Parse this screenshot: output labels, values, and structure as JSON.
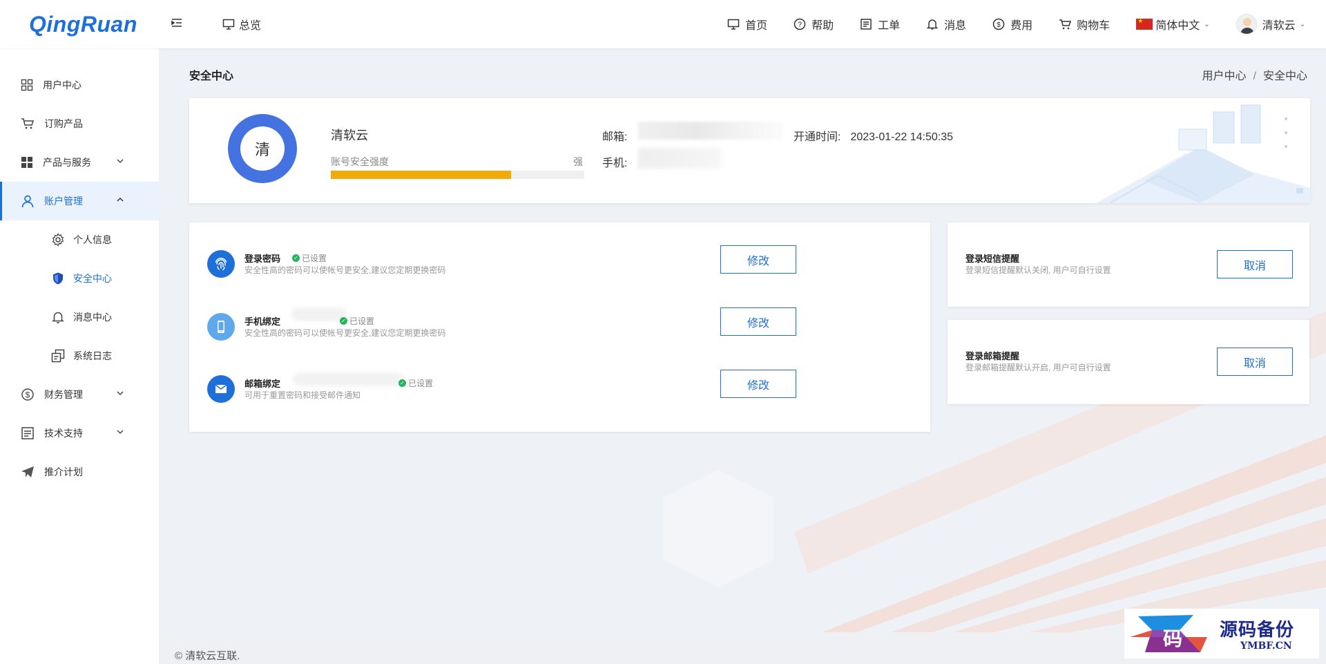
{
  "header": {
    "logo": "QingRuan",
    "overview": "总览",
    "nav": [
      {
        "label": "首页",
        "icon": "monitor-icon"
      },
      {
        "label": "帮助",
        "icon": "help-icon"
      },
      {
        "label": "工单",
        "icon": "ticket-icon"
      },
      {
        "label": "消息",
        "icon": "bell-icon"
      },
      {
        "label": "费用",
        "icon": "dollar-icon"
      },
      {
        "label": "购物车",
        "icon": "cart-icon"
      }
    ],
    "language": "简体中文",
    "username": "清软云"
  },
  "sidebar": {
    "items": [
      {
        "label": "用户中心",
        "icon": "grid-icon"
      },
      {
        "label": "订购产品",
        "icon": "cart-icon"
      },
      {
        "label": "产品与服务",
        "icon": "apps-icon"
      },
      {
        "label": "账户管理",
        "icon": "user-icon"
      }
    ],
    "sub_items": [
      {
        "label": "个人信息",
        "icon": "gear-icon"
      },
      {
        "label": "安全中心",
        "icon": "shield-icon"
      },
      {
        "label": "消息中心",
        "icon": "bell-icon"
      },
      {
        "label": "系统日志",
        "icon": "log-icon"
      }
    ],
    "items_after": [
      {
        "label": "财务管理",
        "icon": "dollar-icon"
      },
      {
        "label": "技术支持",
        "icon": "document-icon"
      },
      {
        "label": "推介计划",
        "icon": "send-icon"
      }
    ]
  },
  "page": {
    "title": "安全中心",
    "breadcrumb": [
      "用户中心",
      "安全中心"
    ]
  },
  "profile": {
    "avatar_char": "清",
    "name": "清软云",
    "strength_label": "账号安全强度",
    "strength_end": "强",
    "strength_level": 0.71,
    "email_label": "邮箱:",
    "phone_label": "手机:",
    "open_time_label": "开通时间:",
    "open_time": "2023-01-22 14:50:35"
  },
  "security": {
    "items": [
      {
        "title": "登录密码",
        "status": "已设置",
        "desc": "安全性高的密码可以使帐号更安全,建议您定期更换密码",
        "button": "修改",
        "icon": "fingerprint-icon"
      },
      {
        "title": "手机绑定",
        "status": "已设置",
        "desc": "安全性高的密码可以使帐号更安全,建议您定期更换密码",
        "button": "修改",
        "icon": "phone-icon"
      },
      {
        "title": "邮箱绑定",
        "status": "已设置",
        "desc": "可用于重置密码和接受邮件通知",
        "button": "修改",
        "icon": "mail-icon"
      }
    ]
  },
  "reminders": [
    {
      "title": "登录短信提醒",
      "desc": "登录短信提醒默认关闭, 用户可自行设置",
      "button": "取消"
    },
    {
      "title": "登录邮箱提醒",
      "desc": "登录邮箱提醒默认开启, 用户可自行设置",
      "button": "取消"
    }
  ],
  "footer": {
    "copyright": "© 清软云互联."
  },
  "watermark": {
    "text": "源码备份",
    "sub": "YMBF.CN"
  },
  "colors": {
    "primary": "#1e6fd9",
    "strength": "#f2a90a",
    "success": "#27b35c"
  }
}
